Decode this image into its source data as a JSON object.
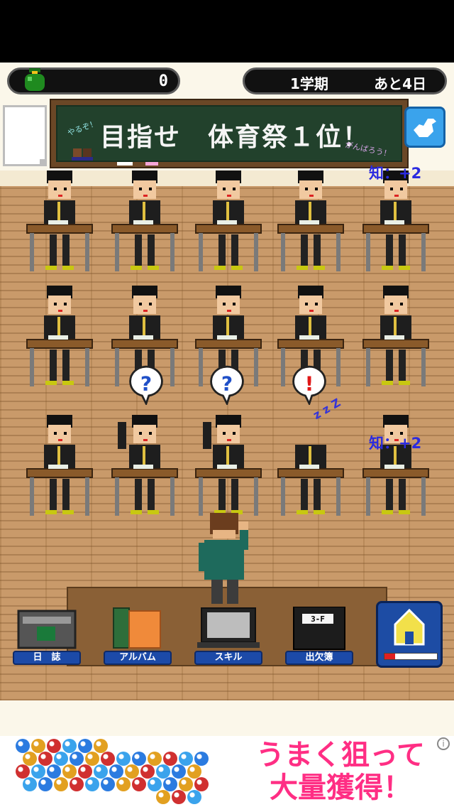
{
  "hud": {
    "money": "0",
    "term": "1学期",
    "days_left": "あと4日"
  },
  "blackboard": {
    "title": "目指せ　体育祭１位！",
    "note_left": "やるぞ！",
    "note_right": "がんばろう！"
  },
  "popups": [
    {
      "text": "知：+2"
    },
    {
      "text": "知：+2"
    }
  ],
  "bubbles": [
    {
      "icon": "question-icon",
      "symbol": "?",
      "color": "#2050c8"
    },
    {
      "icon": "question-icon",
      "symbol": "?",
      "color": "#2050c8"
    },
    {
      "icon": "exclamation-icon",
      "symbol": "!",
      "color": "#e01818"
    }
  ],
  "sleep_text": "z z Z",
  "menu": [
    {
      "label": "日　誌",
      "icon": "journal-icon"
    },
    {
      "label": "アルバム",
      "icon": "album-icon"
    },
    {
      "label": "スキル",
      "icon": "computer-icon"
    },
    {
      "label": "出欠簿",
      "icon": "attendance-book-icon",
      "book_label": "3-F"
    }
  ],
  "school_button": {
    "icon": "school-building-icon",
    "progress": 0.2
  },
  "ad": {
    "line1": "うまく狙って",
    "line2": "大量獲得！",
    "info": "i"
  },
  "colors": {
    "ad_text": "#ff2e84",
    "popup_text": "#2a2ae0",
    "menu_label_bg": "#1c4aa8"
  }
}
